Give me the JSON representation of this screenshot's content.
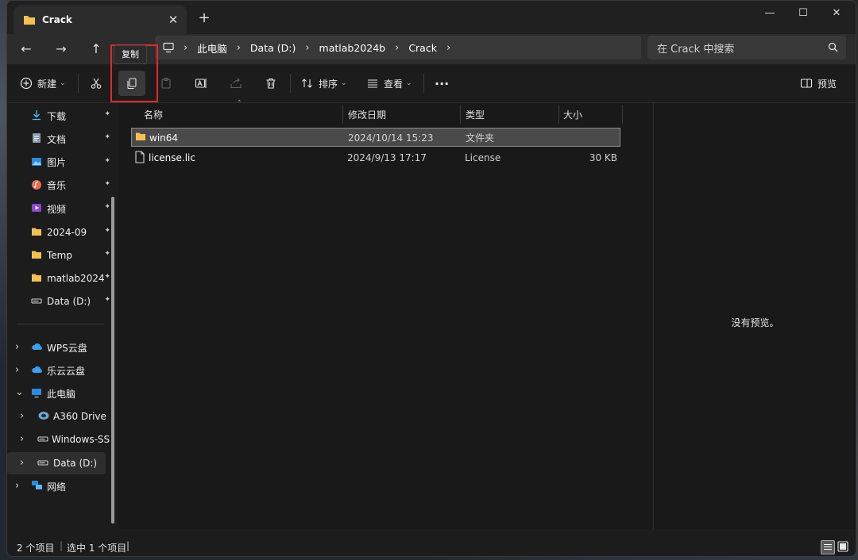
{
  "tab": {
    "title": "Crack",
    "close": "✕",
    "new_tab": "+"
  },
  "window_controls": {
    "minimize": "—",
    "maximize": "☐",
    "close": "✕"
  },
  "nav": {
    "back": "←",
    "forward": "→",
    "up": "↑"
  },
  "address": {
    "crumbs": [
      "此电脑",
      "Data (D:)",
      "matlab2024b",
      "Crack"
    ]
  },
  "search": {
    "placeholder": "在 Crack 中搜索"
  },
  "toolbar": {
    "new_label": "新建",
    "sort_label": "排序",
    "view_label": "查看",
    "more": "···",
    "preview_label": "预览",
    "tooltip": "复制"
  },
  "sidebar": {
    "quick_access": [
      {
        "label": "下载",
        "icon": "download-icon"
      },
      {
        "label": "文档",
        "icon": "document-icon"
      },
      {
        "label": "图片",
        "icon": "picture-icon"
      },
      {
        "label": "音乐",
        "icon": "music-icon"
      },
      {
        "label": "视频",
        "icon": "video-icon"
      },
      {
        "label": "2024-09",
        "icon": "folder-icon"
      },
      {
        "label": "Temp",
        "icon": "folder-icon"
      },
      {
        "label": "matlab2024",
        "icon": "folder-icon"
      },
      {
        "label": "Data (D:)",
        "icon": "drive-icon"
      }
    ],
    "tree": [
      {
        "label": "WPS云盘",
        "icon": "cloud-icon"
      },
      {
        "label": "乐云云盘",
        "icon": "cloud-icon"
      },
      {
        "label": "此电脑",
        "icon": "computer-icon"
      },
      {
        "label": "A360 Drive",
        "icon": "cloud-drive-icon"
      },
      {
        "label": "Windows-SSD",
        "icon": "drive-icon"
      },
      {
        "label": "Data (D:)",
        "icon": "drive-icon"
      },
      {
        "label": "网络",
        "icon": "network-icon"
      }
    ]
  },
  "columns": {
    "name": "名称",
    "modified": "修改日期",
    "type": "类型",
    "size": "大小"
  },
  "files": [
    {
      "name": "win64",
      "modified": "2024/10/14 15:23",
      "type": "文件夹",
      "size": "",
      "icon": "folder-icon"
    },
    {
      "name": "license.lic",
      "modified": "2024/9/13 17:17",
      "type": "License",
      "size": "30 KB",
      "icon": "file-icon"
    }
  ],
  "preview": {
    "empty_text": "没有预览。"
  },
  "status": {
    "items": "2 个项目",
    "selected": "选中 1 个项目"
  },
  "colors": {
    "accent": "#0078d4",
    "highlight_box": "#e02a2a",
    "folder": "#f2c14e"
  }
}
